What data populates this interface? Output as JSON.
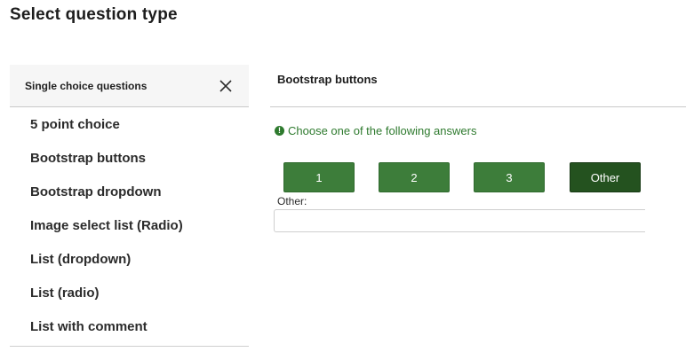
{
  "page": {
    "title": "Select question type"
  },
  "sidebar": {
    "header_label": "Single choice questions",
    "close_icon": "close-icon",
    "items": [
      {
        "label": "5 point choice"
      },
      {
        "label": "Bootstrap buttons"
      },
      {
        "label": "Bootstrap dropdown"
      },
      {
        "label": "Image select list (Radio)"
      },
      {
        "label": "List (dropdown)"
      },
      {
        "label": "List (radio)"
      },
      {
        "label": "List with comment"
      }
    ]
  },
  "preview": {
    "title": "Bootstrap buttons",
    "hint_icon": "exclamation-circle-icon",
    "hint_text": "Choose one of the following answers",
    "answers": [
      {
        "label": "1",
        "selected": false
      },
      {
        "label": "2",
        "selected": false
      },
      {
        "label": "3",
        "selected": false
      },
      {
        "label": "Other",
        "selected": true
      }
    ],
    "other_label": "Other:",
    "other_value": "",
    "other_placeholder": ""
  },
  "colors": {
    "button_green": "#3d7d3a",
    "button_selected": "#24521f",
    "hint_green": "#2e7a2e"
  }
}
